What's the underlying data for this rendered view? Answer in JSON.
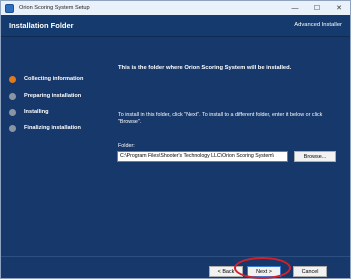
{
  "window": {
    "title": "Orion Scoring System Setup",
    "controls": {
      "minimize": "—",
      "maximize": "☐",
      "close": "✕"
    }
  },
  "header": {
    "title": "Installation Folder",
    "brand": "Advanced Installer"
  },
  "sidebar": {
    "steps": [
      {
        "label": "Collecting information",
        "state": "active"
      },
      {
        "label": "Preparing installation",
        "state": "pending"
      },
      {
        "label": "Installing",
        "state": "pending"
      },
      {
        "label": "Finalizing installation",
        "state": "pending"
      }
    ]
  },
  "panel": {
    "headline": "This is the folder where Orion Scoring System will be installed.",
    "instructions": "To install in this folder, click \"Next\". To install to a different folder, enter it below or click \"Browse\".",
    "folder_label": "Folder:",
    "folder_value": "C:\\Program Files\\Shooter's Technology LLC\\Orion Scoring System\\",
    "browse_label": "Browse..."
  },
  "footer": {
    "back_label": "< Back",
    "next_label": "Next >",
    "cancel_label": "Cancel"
  },
  "colors": {
    "background": "#17386b",
    "active_step": "#e07a1a",
    "pending_step": "#8a95a3",
    "annotation": "#d4202a"
  }
}
